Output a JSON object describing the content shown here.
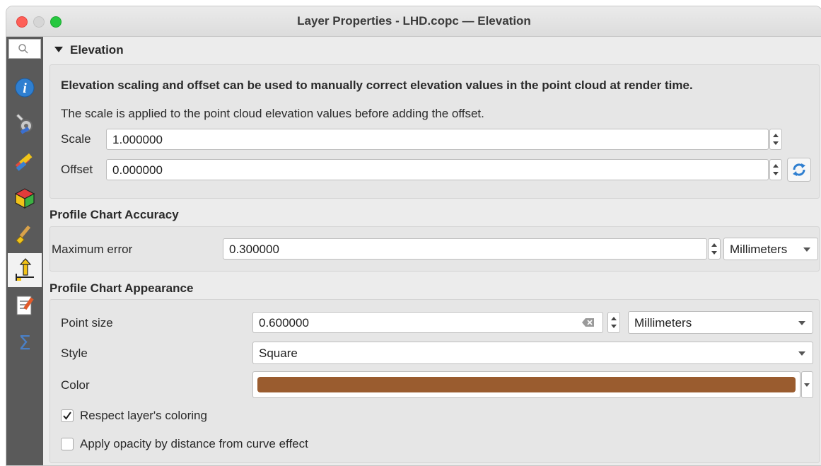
{
  "window": {
    "title": "Layer Properties - LHD.copc — Elevation"
  },
  "sidebar": {
    "search_placeholder": "",
    "icons": [
      "info-icon",
      "source-icon",
      "symbology-icon",
      "3d-view-icon",
      "rendering-icon",
      "elevation-icon",
      "metadata-icon",
      "statistics-icon"
    ]
  },
  "elevation": {
    "header": "Elevation",
    "description_bold": "Elevation scaling and offset can be used to manually correct elevation values in the point cloud at render time.",
    "description": "The scale is applied to the point cloud elevation values before adding the offset.",
    "scale_label": "Scale",
    "scale_value": "1.000000",
    "offset_label": "Offset",
    "offset_value": "0.000000"
  },
  "accuracy": {
    "header": "Profile Chart Accuracy",
    "max_error_label": "Maximum error",
    "max_error_value": "0.300000",
    "units": "Millimeters"
  },
  "appearance": {
    "header": "Profile Chart Appearance",
    "point_size_label": "Point size",
    "point_size_value": "0.600000",
    "point_size_units": "Millimeters",
    "style_label": "Style",
    "style_value": "Square",
    "color_label": "Color",
    "color_value": "#9a5c2f",
    "respect_coloring_label": "Respect layer's coloring",
    "respect_coloring_checked": true,
    "opacity_label": "Apply opacity by distance from curve effect",
    "opacity_checked": false
  }
}
